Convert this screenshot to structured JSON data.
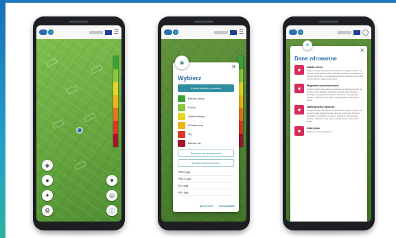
{
  "app": {
    "brand_color": "#2b6fb3",
    "accent_color": "#2f8fa1",
    "icons": [
      "app-logo",
      "eu-flag",
      "hamburger-menu",
      "profile-icon"
    ]
  },
  "phone1": {
    "scale_colors": [
      "#3aa23a",
      "#8cc63f",
      "#e4d623",
      "#f2b21a",
      "#e8731a",
      "#d93a26",
      "#a1162a"
    ],
    "fab_left": [
      "layers-icon",
      "location-icon",
      "compass-icon"
    ],
    "fab_right": [
      "shield-icon",
      "locate-icon",
      "info-icon"
    ]
  },
  "phone2": {
    "title": "Wybierz",
    "selected": "Indeks jakości powietrza",
    "levels": [
      {
        "label": "Bardzo dobry",
        "color": "#3aa23a"
      },
      {
        "label": "Dobry",
        "color": "#8cc63f"
      },
      {
        "label": "Umiarkowany",
        "color": "#e4d623"
      },
      {
        "label": "Dostateczny",
        "color": "#f2b21a"
      },
      {
        "label": "Zły",
        "color": "#d93a26"
      },
      {
        "label": "Bardzo zły",
        "color": "#a1162a"
      }
    ],
    "btn1": "Stężenie zanieczyszczeń",
    "btn2": "Emisja zanieczyszczeń",
    "metrics": [
      "PM10 [µg]",
      "PM2,5 [µg]",
      "SO₂ [µg]",
      "NO₂ [µg]"
    ],
    "cancel": "WYCZYŚĆ",
    "confirm": "ZATWIERDŹ"
  },
  "phone3": {
    "title": "Dane zdrowotne",
    "items": [
      {
        "name": "Zawał serca",
        "desc": "Prognozowany stan jakości powietrza nie wpływa istotnie na wzrost ryzyka zawału serca. Możesz spokojnie przebywać na wolnym powietrzu, ale pamiętaj proszę o zdrowym stylu życia i przyjmowaniu zaleconych leków."
      },
      {
        "name": "Migotanie przedsionków",
        "desc": "Prognozowany stan jakości powietrza nie wpływa istotnie na wzrost ryzyka napadu migotania przedsionków. Możesz spokojnie przebywać na wolnym powietrzu, ale pamiętaj proszę o zdrowym stylu życia i przyjmowaniu zaleconych leków."
      },
      {
        "name": "Nadciśnienie tętnicze",
        "desc": "Prognozowany stan jakości powietrza nie wpływa istotnie na wzrost ryzyka podwyższenia ciśnienia tętniczego. Możesz spokojnie przebywać na wolnym powietrzu, ale pamiętaj proszę o zdrowym stylu życia i przyjmowaniu zaleconych leków."
      },
      {
        "name": "Zator płuc",
        "desc": "Prognozowany stan jakości"
      }
    ]
  }
}
